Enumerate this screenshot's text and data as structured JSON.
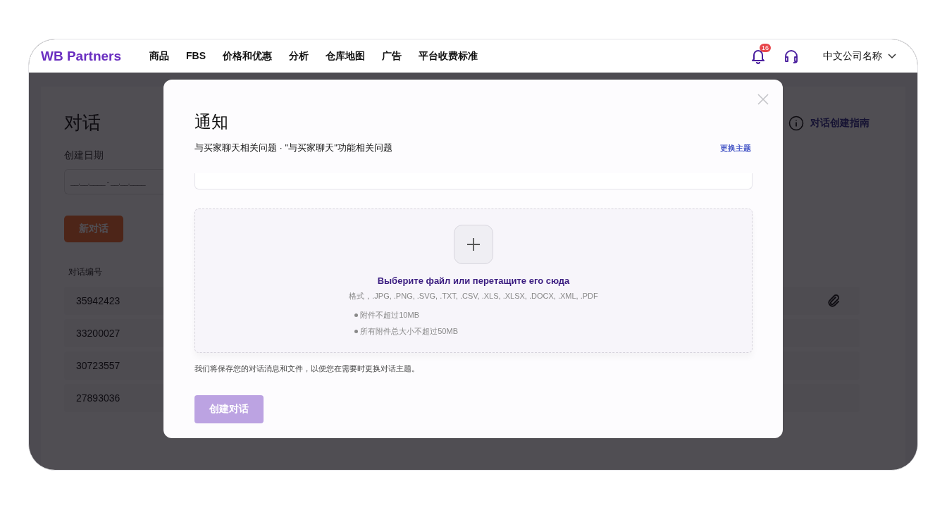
{
  "nav": {
    "logo": "WB Partners",
    "items": [
      {
        "label": "商品"
      },
      {
        "label": "FBS"
      },
      {
        "label": "价格和优惠"
      },
      {
        "label": "分析"
      },
      {
        "label": "仓库地图"
      },
      {
        "label": "广告"
      },
      {
        "label": "平台收费标准"
      }
    ],
    "notification_count": "16",
    "company": "中文公司名称"
  },
  "background_page": {
    "title": "对话",
    "guide_link": "对话创建指南",
    "date_label": "创建日期",
    "date_field": {
      "placeholder": "__.__.____ - __.__.____"
    },
    "new_button": "新对话",
    "column_header": "对话编号",
    "rows": [
      {
        "id": "35942423",
        "attachment": true
      },
      {
        "id": "33200027",
        "attachment": false
      },
      {
        "id": "30723557",
        "attachment": false
      },
      {
        "id": "27893036",
        "attachment": false
      }
    ]
  },
  "modal": {
    "title": "通知",
    "subtitle": "与买家聊天相关问题 · \"与买家聊天\"功能相关问题",
    "change_topic_link": "更换主题",
    "dropzone": {
      "title": "Выберите файл или перетащите его сюда",
      "formats": "格式，.JPG, .PNG, .SVG, .TXT, .CSV, .XLS, .XLSX, .DOCX, .XML, .PDF",
      "rules": [
        "附件不超过10MB",
        "所有附件总大小不超过50MB"
      ]
    },
    "note": "我们将保存您的对话消息和文件，以便您在需要时更换对话主题。",
    "create_button": {
      "label": "创建对话",
      "disabled": true
    }
  }
}
